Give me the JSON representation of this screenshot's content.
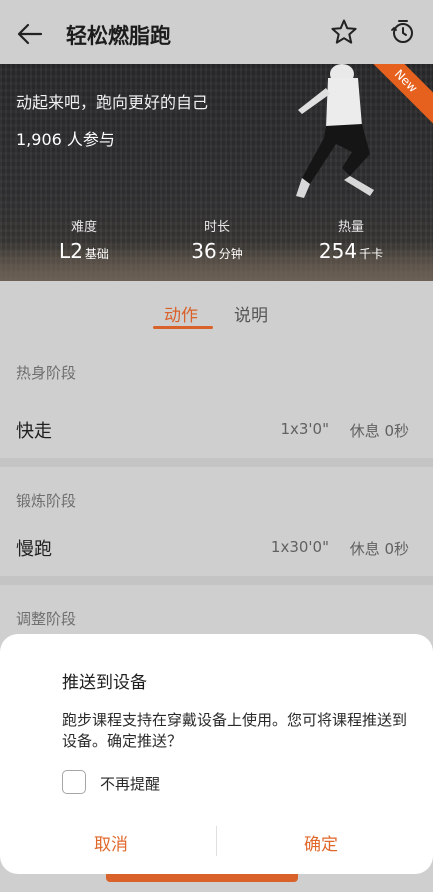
{
  "header": {
    "title": "轻松燃脂跑",
    "back_icon": "arrow-left-icon",
    "favorite_icon": "star-icon",
    "history_icon": "timer-history-icon"
  },
  "hero": {
    "slogan": "动起来吧，跑向更好的自己",
    "participants": "1,906 人参与",
    "badge": "New",
    "stats": [
      {
        "label": "难度",
        "value": "L2",
        "unit": "基础"
      },
      {
        "label": "时长",
        "value": "36",
        "unit": "分钟"
      },
      {
        "label": "热量",
        "value": "254",
        "unit": "千卡"
      }
    ]
  },
  "tabs": {
    "active": "动作",
    "inactive": "说明"
  },
  "stages": [
    {
      "title": "热身阶段",
      "exercise": "快走",
      "duration": "1x3'0\"",
      "rest": "休息 0秒"
    },
    {
      "title": "锻炼阶段",
      "exercise": "慢跑",
      "duration": "1x30'0\"",
      "rest": "休息 0秒"
    },
    {
      "title": "调整阶段"
    }
  ],
  "dialog": {
    "title": "推送到设备",
    "body": "跑步课程支持在穿戴设备上使用。您可将课程推送到设备。确定推送？",
    "checkbox_label": "不再提醒",
    "checkbox_checked": false,
    "cancel": "取消",
    "confirm": "确定"
  },
  "colors": {
    "accent": "#d9622a",
    "overlay_background": "#cfcfcf",
    "dialog_background": "#ffffff"
  }
}
